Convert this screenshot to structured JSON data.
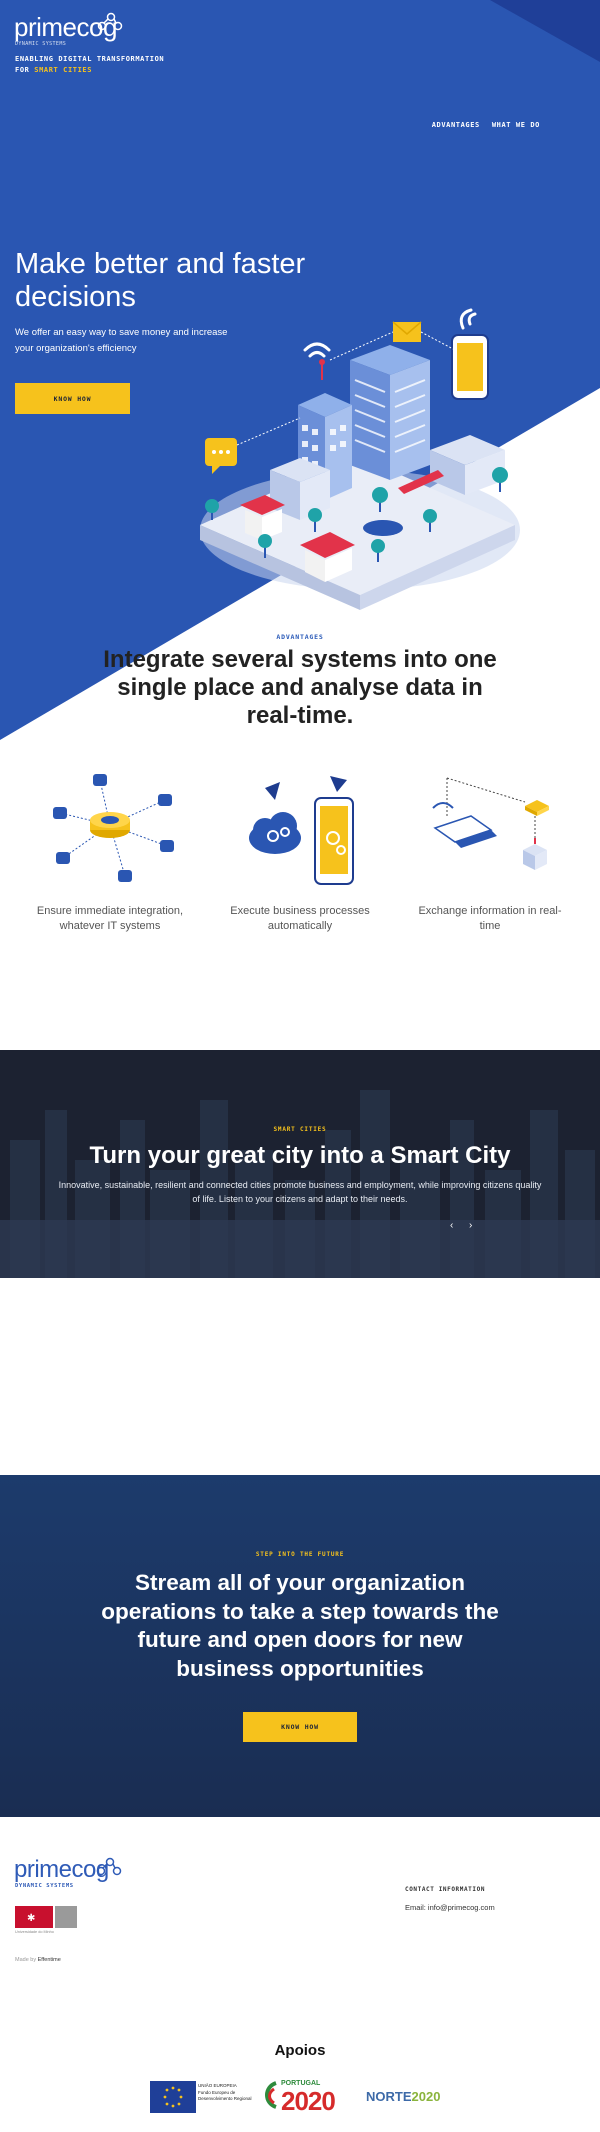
{
  "brand": {
    "logo_text": "primecog",
    "logo_sub": "DYNAMIC SYSTEMS",
    "tagline_line1": "ENABLING DIGITAL TRANSFORMATION",
    "tagline_for": "FOR",
    "tagline_highlight": "SMART CITIES"
  },
  "nav": {
    "items": [
      {
        "label": "ADVANTAGES"
      },
      {
        "label": "WHAT WE DO"
      }
    ]
  },
  "hero": {
    "title": "Make better and faster decisions",
    "subtitle": "We offer an easy way to save money and increase your organization's efficiency",
    "button_label": "KNOW HOW"
  },
  "advantages": {
    "label": "ADVANTAGES",
    "title": "Integrate several systems into one single place and analyse data in real-time.",
    "features": [
      {
        "text": "Ensure immediate integration, whatever IT systems",
        "icon": "database-network-icon"
      },
      {
        "text": "Execute business processes automatically",
        "icon": "cloud-phone-icon"
      },
      {
        "text": "Exchange information in real-time",
        "icon": "laptop-exchange-icon"
      }
    ]
  },
  "smart_city": {
    "label": "SMART CITIES",
    "title": "Turn your great city into a Smart City",
    "text": "Innovative, sustainable, resilient and connected cities promote business and employment, while improving citizens quality of life. Listen to your citizens and adapt to their needs.",
    "prev_symbol": "‹",
    "next_symbol": "›"
  },
  "stream": {
    "label": "STEP INTO THE FUTURE",
    "title": "Stream all of your organization operations to take a step towards the future and open doors for new business opportunities",
    "button_label": "KNOW HOW"
  },
  "footer": {
    "logo_text": "primecog",
    "logo_sub": "DYNAMIC SYSTEMS",
    "badge_text": "Universidade do Minho",
    "made_by_prefix": "Made by",
    "made_by_name": "Effentime",
    "contact_heading": "CONTACT INFORMATION",
    "contact_email": "Email: info@primecog.com"
  },
  "apoios": {
    "title": "Apoios",
    "eu_label": "UNIÃO EUROPEIA",
    "eu_fund_line1": "Fundo Europeu de",
    "eu_fund_line2": "Desenvolvimento Regional",
    "portugal_label": "PORTUGAL",
    "portugal_year": "2020",
    "norte_main": "NORTE",
    "norte_year": "2020"
  },
  "colors": {
    "hero_blue": "#2a56b2",
    "accent_yellow": "#f6c21c",
    "dark_band": "#1c2231",
    "stream_blue": "#1c3b6c"
  }
}
